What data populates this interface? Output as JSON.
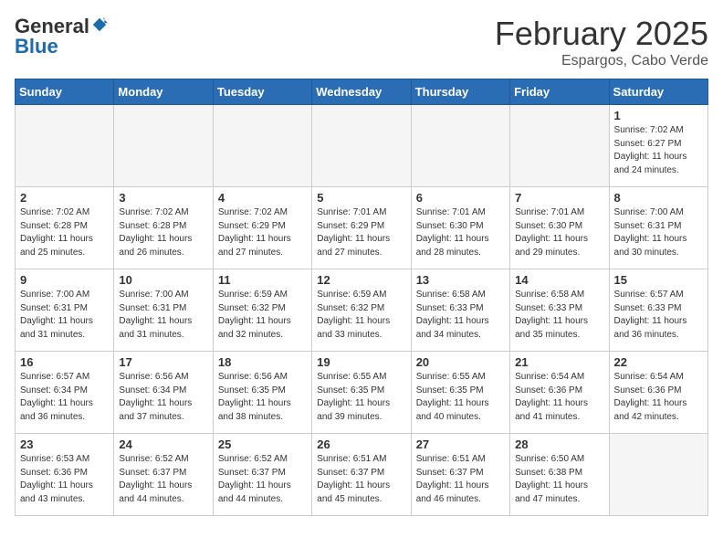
{
  "header": {
    "logo": {
      "general": "General",
      "blue": "Blue"
    },
    "title": "February 2025",
    "subtitle": "Espargos, Cabo Verde"
  },
  "weekdays": [
    "Sunday",
    "Monday",
    "Tuesday",
    "Wednesday",
    "Thursday",
    "Friday",
    "Saturday"
  ],
  "weeks": [
    [
      {
        "day": null
      },
      {
        "day": null
      },
      {
        "day": null
      },
      {
        "day": null
      },
      {
        "day": null
      },
      {
        "day": null
      },
      {
        "day": 1,
        "sunrise": "7:02 AM",
        "sunset": "6:27 PM",
        "daylight": "11 hours and 24 minutes."
      }
    ],
    [
      {
        "day": 2,
        "sunrise": "7:02 AM",
        "sunset": "6:28 PM",
        "daylight": "11 hours and 25 minutes."
      },
      {
        "day": 3,
        "sunrise": "7:02 AM",
        "sunset": "6:28 PM",
        "daylight": "11 hours and 26 minutes."
      },
      {
        "day": 4,
        "sunrise": "7:02 AM",
        "sunset": "6:29 PM",
        "daylight": "11 hours and 27 minutes."
      },
      {
        "day": 5,
        "sunrise": "7:01 AM",
        "sunset": "6:29 PM",
        "daylight": "11 hours and 27 minutes."
      },
      {
        "day": 6,
        "sunrise": "7:01 AM",
        "sunset": "6:30 PM",
        "daylight": "11 hours and 28 minutes."
      },
      {
        "day": 7,
        "sunrise": "7:01 AM",
        "sunset": "6:30 PM",
        "daylight": "11 hours and 29 minutes."
      },
      {
        "day": 8,
        "sunrise": "7:00 AM",
        "sunset": "6:31 PM",
        "daylight": "11 hours and 30 minutes."
      }
    ],
    [
      {
        "day": 9,
        "sunrise": "7:00 AM",
        "sunset": "6:31 PM",
        "daylight": "11 hours and 31 minutes."
      },
      {
        "day": 10,
        "sunrise": "7:00 AM",
        "sunset": "6:31 PM",
        "daylight": "11 hours and 31 minutes."
      },
      {
        "day": 11,
        "sunrise": "6:59 AM",
        "sunset": "6:32 PM",
        "daylight": "11 hours and 32 minutes."
      },
      {
        "day": 12,
        "sunrise": "6:59 AM",
        "sunset": "6:32 PM",
        "daylight": "11 hours and 33 minutes."
      },
      {
        "day": 13,
        "sunrise": "6:58 AM",
        "sunset": "6:33 PM",
        "daylight": "11 hours and 34 minutes."
      },
      {
        "day": 14,
        "sunrise": "6:58 AM",
        "sunset": "6:33 PM",
        "daylight": "11 hours and 35 minutes."
      },
      {
        "day": 15,
        "sunrise": "6:57 AM",
        "sunset": "6:33 PM",
        "daylight": "11 hours and 36 minutes."
      }
    ],
    [
      {
        "day": 16,
        "sunrise": "6:57 AM",
        "sunset": "6:34 PM",
        "daylight": "11 hours and 36 minutes."
      },
      {
        "day": 17,
        "sunrise": "6:56 AM",
        "sunset": "6:34 PM",
        "daylight": "11 hours and 37 minutes."
      },
      {
        "day": 18,
        "sunrise": "6:56 AM",
        "sunset": "6:35 PM",
        "daylight": "11 hours and 38 minutes."
      },
      {
        "day": 19,
        "sunrise": "6:55 AM",
        "sunset": "6:35 PM",
        "daylight": "11 hours and 39 minutes."
      },
      {
        "day": 20,
        "sunrise": "6:55 AM",
        "sunset": "6:35 PM",
        "daylight": "11 hours and 40 minutes."
      },
      {
        "day": 21,
        "sunrise": "6:54 AM",
        "sunset": "6:36 PM",
        "daylight": "11 hours and 41 minutes."
      },
      {
        "day": 22,
        "sunrise": "6:54 AM",
        "sunset": "6:36 PM",
        "daylight": "11 hours and 42 minutes."
      }
    ],
    [
      {
        "day": 23,
        "sunrise": "6:53 AM",
        "sunset": "6:36 PM",
        "daylight": "11 hours and 43 minutes."
      },
      {
        "day": 24,
        "sunrise": "6:52 AM",
        "sunset": "6:37 PM",
        "daylight": "11 hours and 44 minutes."
      },
      {
        "day": 25,
        "sunrise": "6:52 AM",
        "sunset": "6:37 PM",
        "daylight": "11 hours and 44 minutes."
      },
      {
        "day": 26,
        "sunrise": "6:51 AM",
        "sunset": "6:37 PM",
        "daylight": "11 hours and 45 minutes."
      },
      {
        "day": 27,
        "sunrise": "6:51 AM",
        "sunset": "6:37 PM",
        "daylight": "11 hours and 46 minutes."
      },
      {
        "day": 28,
        "sunrise": "6:50 AM",
        "sunset": "6:38 PM",
        "daylight": "11 hours and 47 minutes."
      },
      {
        "day": null
      }
    ]
  ]
}
